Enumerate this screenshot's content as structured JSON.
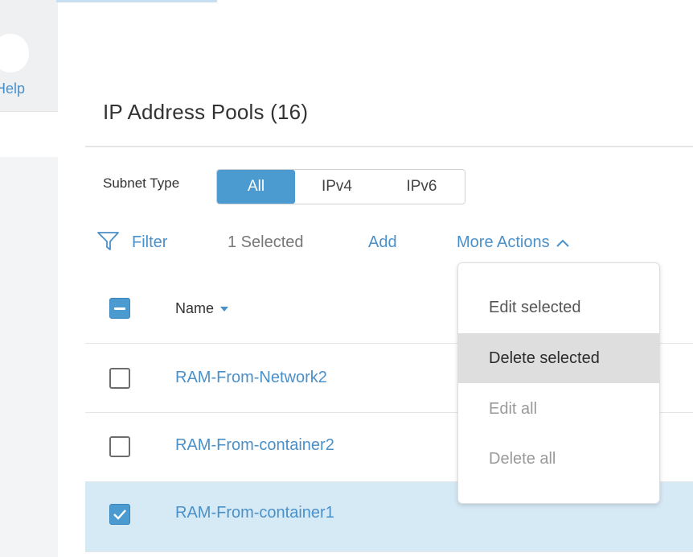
{
  "sidebar": {
    "help_label": "Help"
  },
  "page": {
    "title": "IP Address Pools (16)"
  },
  "subnet_type": {
    "label": "Subnet Type",
    "options": [
      "All",
      "IPv4",
      "IPv6"
    ],
    "selected": "All"
  },
  "toolbar": {
    "filter_label": "Filter",
    "selected_count": "1 Selected",
    "add_label": "Add",
    "more_actions_label": "More Actions"
  },
  "table": {
    "header": {
      "name": "Name"
    },
    "rows": [
      {
        "name": "RAM-From-Network2",
        "checked": false
      },
      {
        "name": "RAM-From-container2",
        "checked": false
      },
      {
        "name": "RAM-From-container1",
        "checked": true
      }
    ]
  },
  "more_actions_menu": {
    "items": [
      {
        "label": "Edit selected",
        "state": "enabled"
      },
      {
        "label": "Delete selected",
        "state": "hover"
      },
      {
        "label": "Edit all",
        "state": "disabled"
      },
      {
        "label": "Delete all",
        "state": "disabled"
      }
    ]
  },
  "colors": {
    "accent": "#4b9bd1",
    "link": "#4a90c9",
    "selected_row": "#d6eaf6"
  }
}
